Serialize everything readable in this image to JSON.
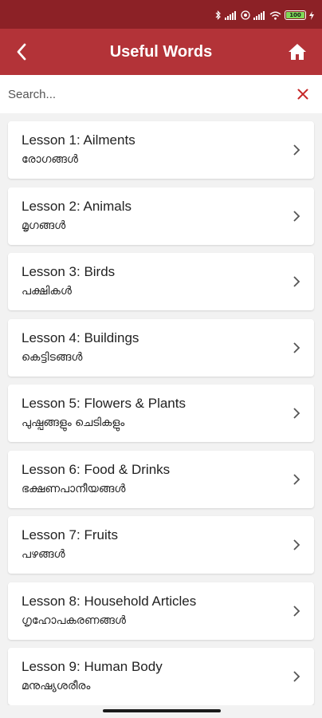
{
  "app_bar": {
    "title": "Useful Words",
    "back_icon": "chevron-left-icon",
    "home_icon": "home-icon"
  },
  "status_bar": {
    "battery": "100",
    "icons": [
      "bluetooth-icon",
      "signal-icon",
      "alarm-icon",
      "signal-icon",
      "wifi-icon",
      "battery-icon",
      "charging-icon"
    ]
  },
  "search": {
    "placeholder": "Search...",
    "value": "",
    "clear_icon": "close-icon"
  },
  "lessons": [
    {
      "title": "Lesson 1: Ailments",
      "subtitle": "രോഗങ്ങൾ"
    },
    {
      "title": "Lesson 2: Animals",
      "subtitle": "മൃഗങ്ങൾ"
    },
    {
      "title": "Lesson 3: Birds",
      "subtitle": "പക്ഷികൾ"
    },
    {
      "title": "Lesson 4: Buildings",
      "subtitle": "കെട്ടിടങ്ങൾ"
    },
    {
      "title": "Lesson 5: Flowers & Plants",
      "subtitle": "പുഷ്പങ്ങളും ചെടികളും"
    },
    {
      "title": "Lesson 6: Food & Drinks",
      "subtitle": "ഭക്ഷണപാനീയങ്ങൾ"
    },
    {
      "title": "Lesson 7: Fruits",
      "subtitle": "പഴങ്ങൾ"
    },
    {
      "title": "Lesson 8: Household Articles",
      "subtitle": "ഗൃഹോപകരണങ്ങൾ"
    },
    {
      "title": "Lesson 9: Human Body",
      "subtitle": "മനുഷ്യശരീരം"
    }
  ],
  "colors": {
    "status_bar": "#8c2126",
    "app_bar": "#b33338",
    "background": "#f2f2f2",
    "clear_icon": "#c62828"
  }
}
